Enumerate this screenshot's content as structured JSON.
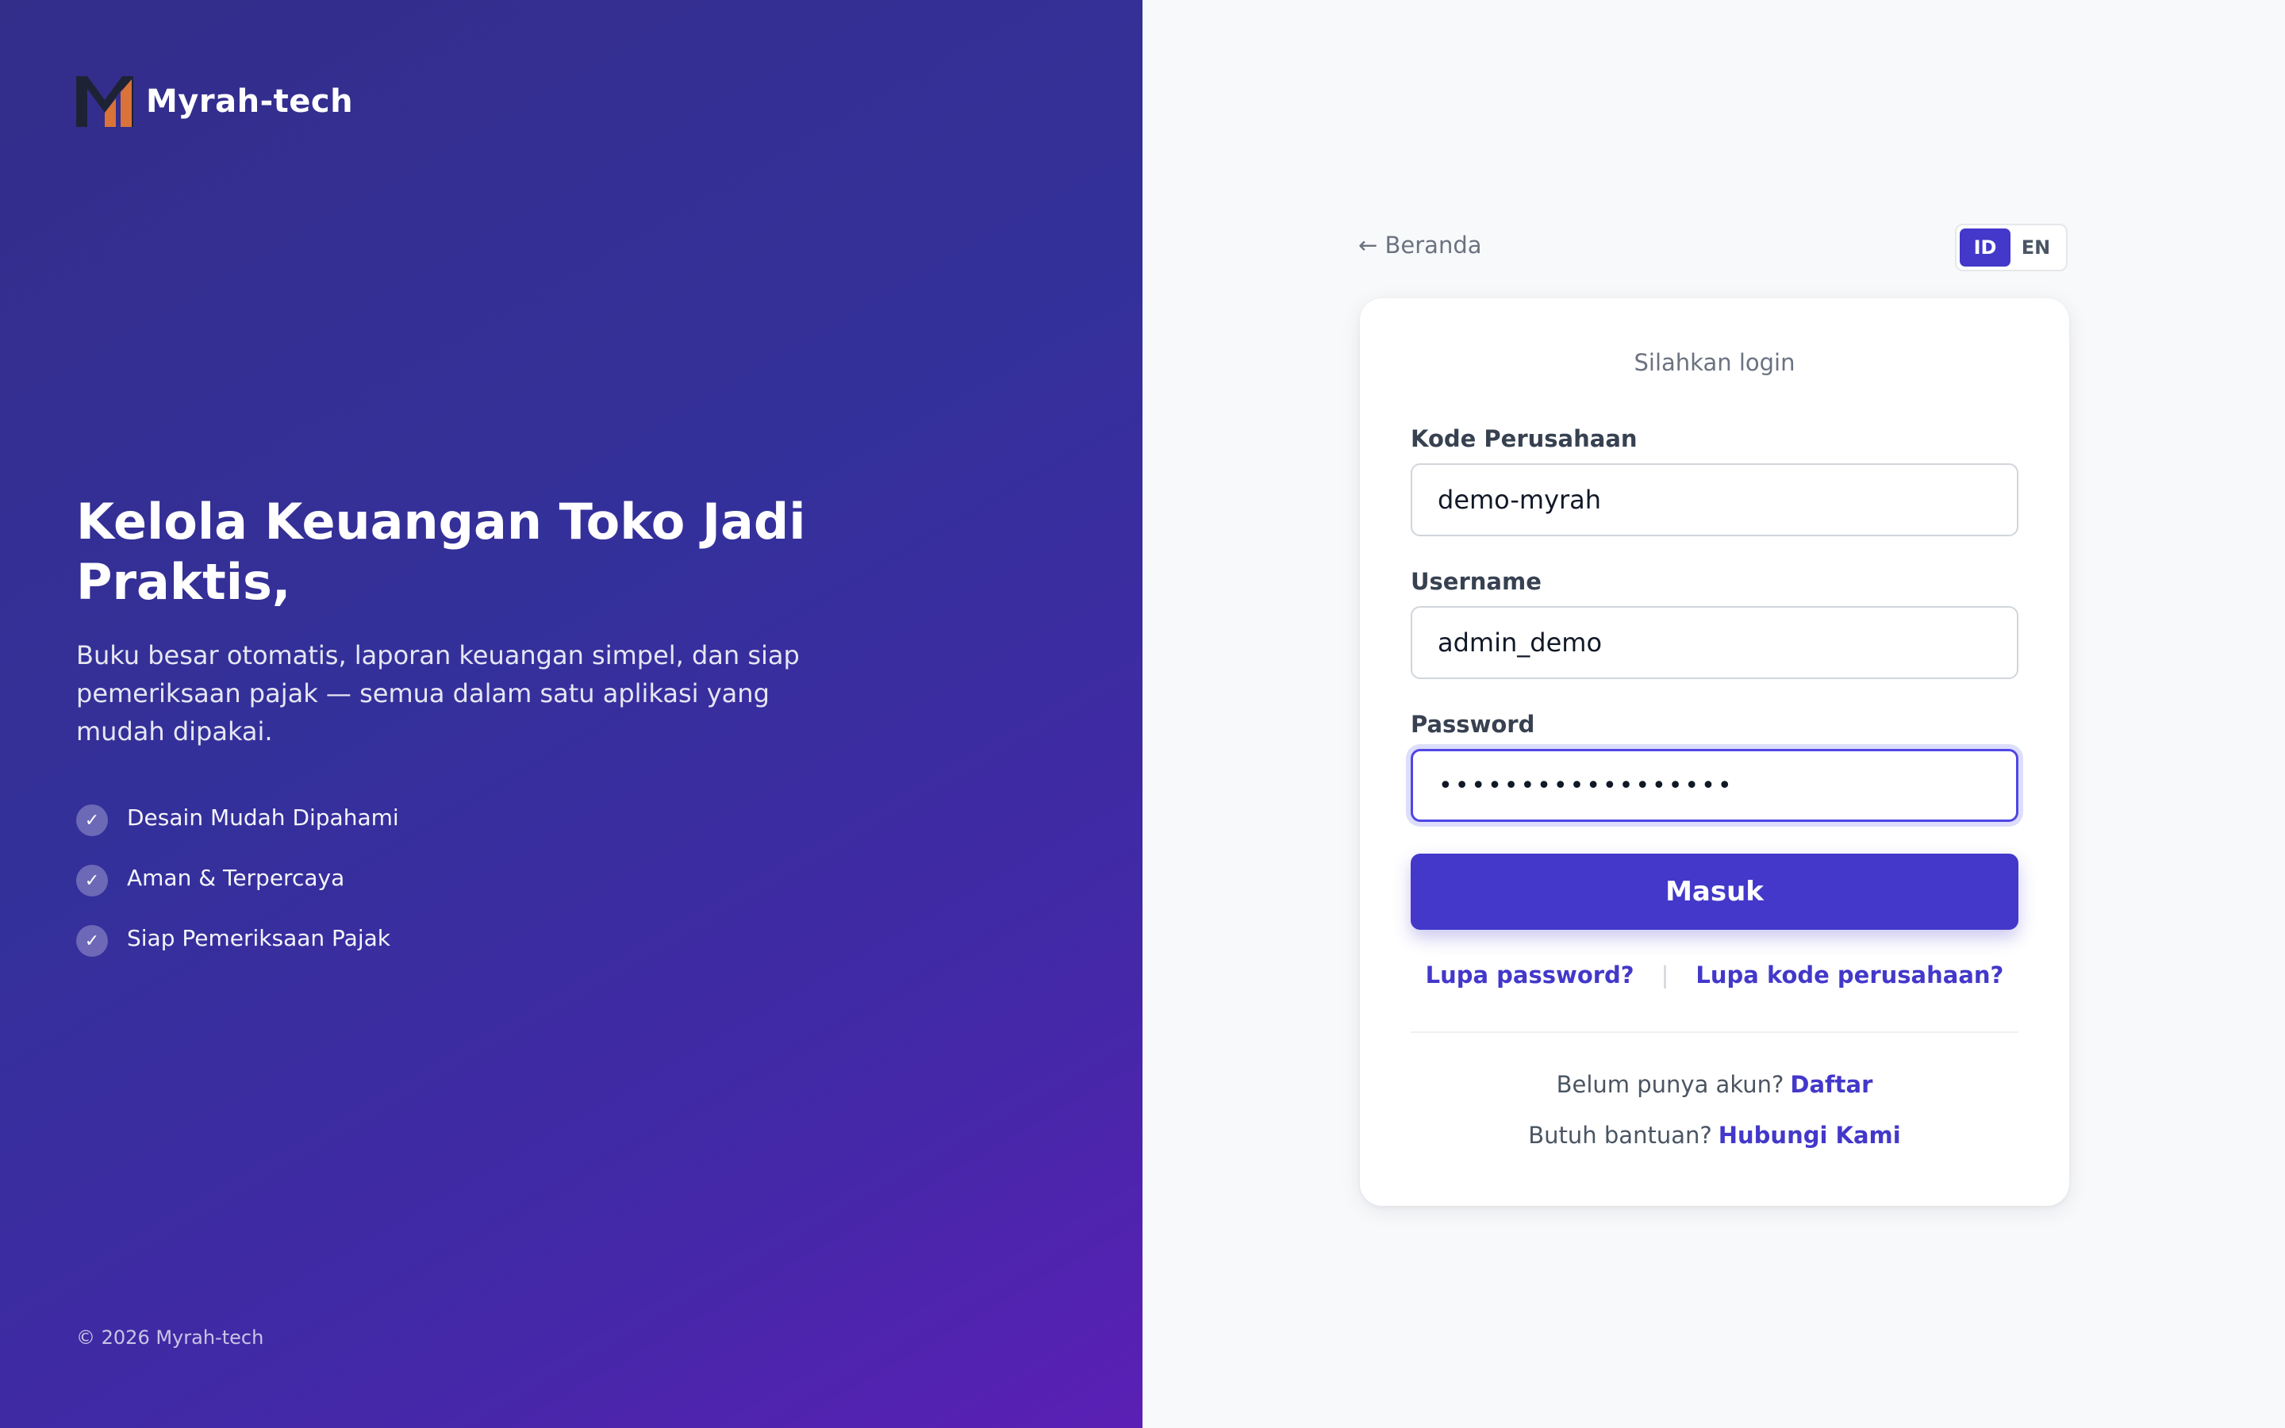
{
  "brand": {
    "name": "Myrah-tech",
    "logo_icon": "myrah-m-logo",
    "logo_colors": {
      "dark": "#1e2235",
      "accent": "#d9733a"
    }
  },
  "hero": {
    "title": "Kelola Keuangan Toko Jadi Praktis,",
    "description": "Buku besar otomatis, laporan keuangan simpel, dan siap pemeriksaan pajak — semua dalam satu aplikasi yang mudah dipakai.",
    "features": [
      {
        "icon": "check-icon",
        "check": "✓",
        "label": "Desain Mudah Dipahami"
      },
      {
        "icon": "check-icon",
        "check": "✓",
        "label": "Aman & Terpercaya"
      },
      {
        "icon": "check-icon",
        "check": "✓",
        "label": "Siap Pemeriksaan Pajak"
      }
    ],
    "copyright": "© 2026 Myrah-tech",
    "gradient_colors": [
      "#332e8a",
      "#34309b",
      "#4428a8",
      "#5b1fb5"
    ]
  },
  "topbar": {
    "home_link": "← Beranda",
    "languages": [
      {
        "code": "ID",
        "active": true
      },
      {
        "code": "EN",
        "active": false
      }
    ]
  },
  "login": {
    "subtitle": "Silahkan login",
    "company_code": {
      "label": "Kode Perusahaan",
      "value": "demo-myrah"
    },
    "username": {
      "label": "Username",
      "value": "admin_demo"
    },
    "password": {
      "label": "Password",
      "value": "••••••••••••••••••"
    },
    "submit_label": "Masuk",
    "forgot_password": "Lupa password?",
    "separator": "|",
    "forgot_company_code": "Lupa kode perusahaan?",
    "register_prompt": "Belum punya akun?",
    "register_link": "Daftar",
    "help_prompt": "Butuh bantuan?",
    "help_link": "Hubungi Kami"
  },
  "colors": {
    "primary": "#4338ca",
    "focus_ring": "#4f46e5",
    "right_background": "#f8f9fb"
  }
}
